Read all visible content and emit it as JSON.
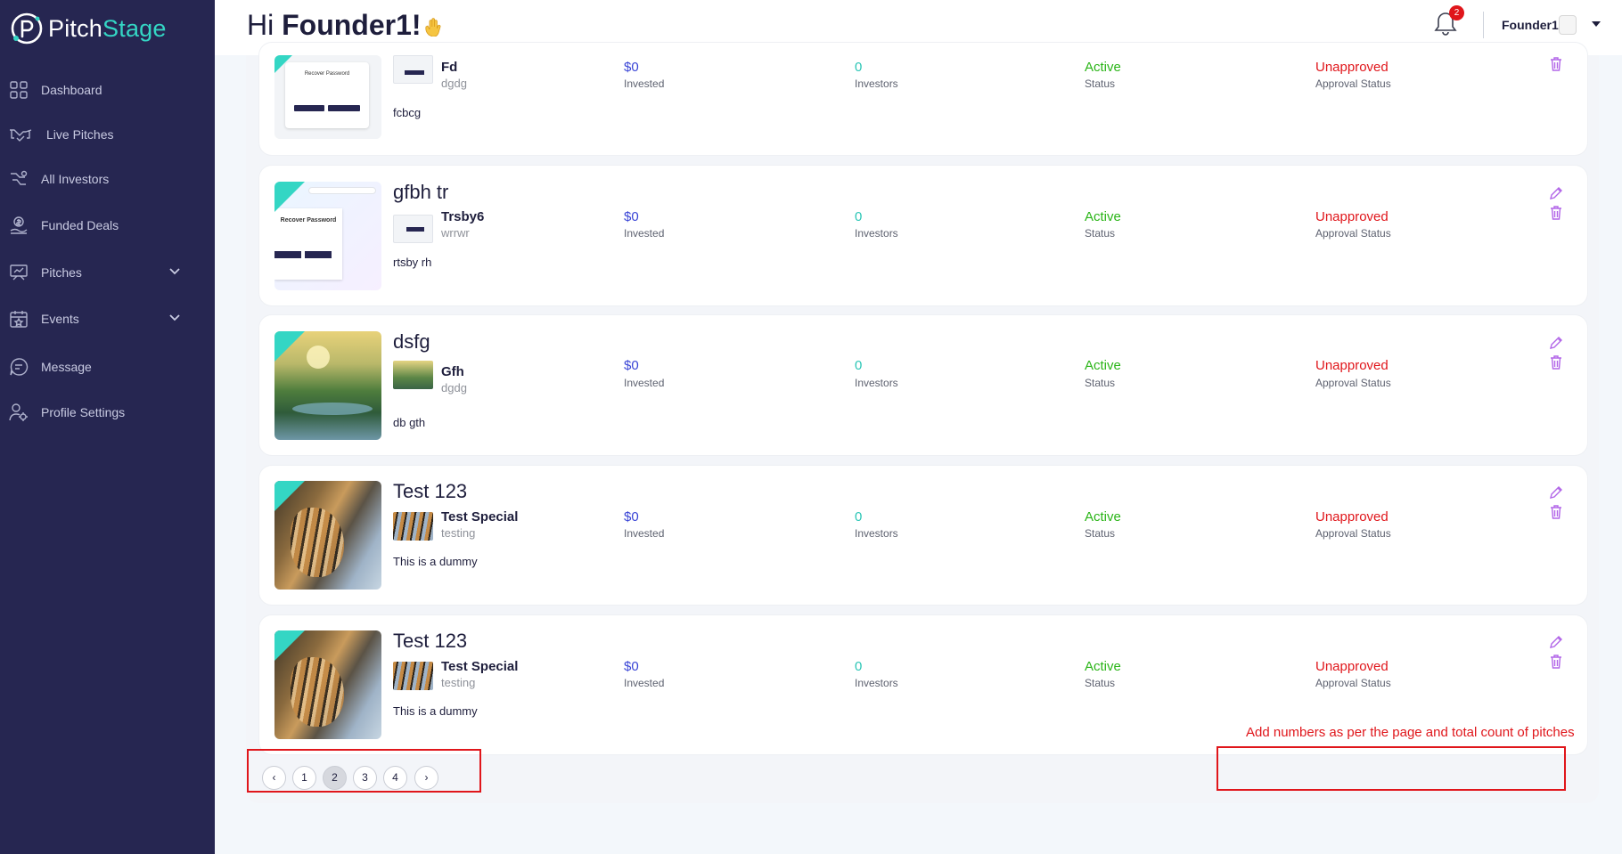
{
  "brand": {
    "pitch": "Pitch",
    "stage": "Stage"
  },
  "sidebar": {
    "items": [
      {
        "label": "Dashboard",
        "icon": "dashboard-icon"
      },
      {
        "label": "Live Pitches",
        "icon": "handshake-icon"
      },
      {
        "label": "All Investors",
        "icon": "investors-icon"
      },
      {
        "label": "Funded Deals",
        "icon": "funded-icon"
      },
      {
        "label": "Pitches",
        "icon": "pitches-icon",
        "expandable": true
      },
      {
        "label": "Events",
        "icon": "events-icon",
        "expandable": true
      },
      {
        "label": "Message",
        "icon": "message-icon"
      },
      {
        "label": "Profile Settings",
        "icon": "profile-settings-icon"
      }
    ]
  },
  "header": {
    "greeting": "Hi",
    "username": "Founder1!",
    "notification_count": "2",
    "user_name": "Founder1"
  },
  "pitches": [
    {
      "title": "",
      "company": "Fd",
      "company_sub": "dgdg",
      "description": "fcbcg",
      "invested_value": "$0",
      "invested_label": "Invested",
      "investors_value": "0",
      "investors_label": "Investors",
      "status_value": "Active",
      "status_label": "Status",
      "approval_value": "Unapproved",
      "approval_label": "Approval Status",
      "thumb_text": "Recover Password"
    },
    {
      "title": "gfbh tr",
      "company": "Trsby6",
      "company_sub": "wrrwr",
      "description": "rtsby rh",
      "invested_value": "$0",
      "invested_label": "Invested",
      "investors_value": "0",
      "investors_label": "Investors",
      "status_value": "Active",
      "status_label": "Status",
      "approval_value": "Unapproved",
      "approval_label": "Approval Status",
      "thumb_text": "Recover Password"
    },
    {
      "title": "dsfg",
      "company": "Gfh",
      "company_sub": "dgdg",
      "description": "db gth",
      "invested_value": "$0",
      "invested_label": "Invested",
      "investors_value": "0",
      "investors_label": "Investors",
      "status_value": "Active",
      "status_label": "Status",
      "approval_value": "Unapproved",
      "approval_label": "Approval Status"
    },
    {
      "title": "Test 123",
      "company": "Test Special",
      "company_sub": "testing",
      "description": "This is a dummy",
      "invested_value": "$0",
      "invested_label": "Invested",
      "investors_value": "0",
      "investors_label": "Investors",
      "status_value": "Active",
      "status_label": "Status",
      "approval_value": "Unapproved",
      "approval_label": "Approval Status"
    },
    {
      "title": "Test 123",
      "company": "Test Special",
      "company_sub": "testing",
      "description": "This is a dummy",
      "invested_value": "$0",
      "invested_label": "Invested",
      "investors_value": "0",
      "investors_label": "Investors",
      "status_value": "Active",
      "status_label": "Status",
      "approval_value": "Unapproved",
      "approval_label": "Approval Status"
    }
  ],
  "pagination": {
    "prev": "‹",
    "next": "›",
    "pages": [
      "1",
      "2",
      "3",
      "4"
    ],
    "current": "2"
  },
  "annotation": {
    "text": "Add numbers as per the page and total count of pitches"
  },
  "colors": {
    "sidebar_bg": "#262651",
    "accent_teal": "#34d6c4",
    "invested_blue": "#3b46d6",
    "active_green": "#2bb518",
    "unapproved_red": "#e0161b",
    "action_purple": "#b266e8"
  }
}
